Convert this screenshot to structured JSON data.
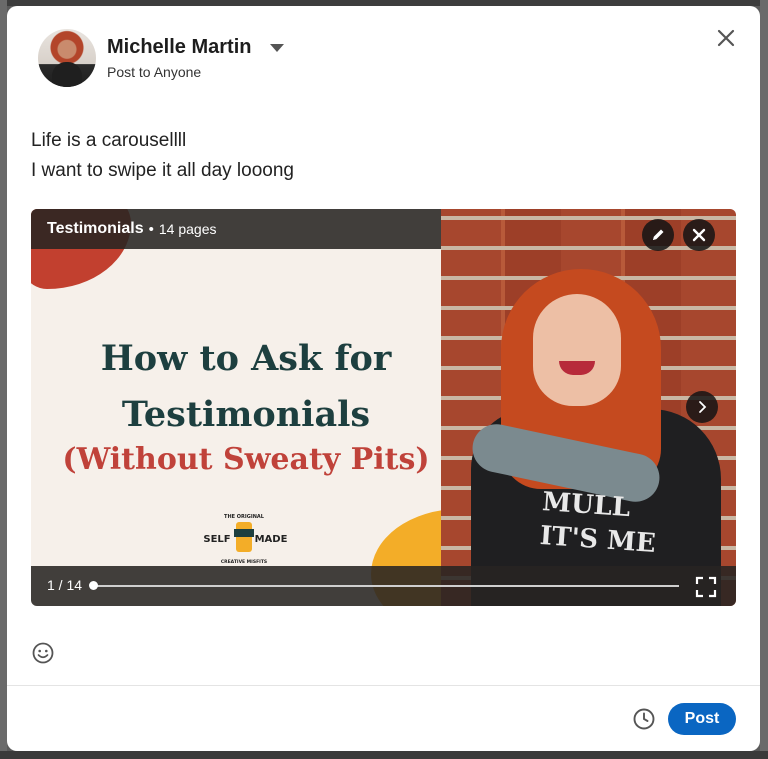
{
  "author": {
    "name": "Michelle Martin",
    "audience": "Post to Anyone"
  },
  "post": {
    "lines": [
      "Life is a carousellll",
      "I want to swipe it all day looong"
    ]
  },
  "document": {
    "title": "Testimonials",
    "separator": "•",
    "pages_label": "14 pages",
    "slide_title_line1": "How to Ask for",
    "slide_title_line2": "Testimonials",
    "slide_subtitle": "(Without Sweaty Pits)",
    "brand_top": "THE ORIGINAL",
    "brand_left": "SELF",
    "brand_right": "MADE",
    "brand_bottom": "CREATIVE MISFITS",
    "shirt_text_line1": "MULL",
    "shirt_text_line2": "IT'S ME",
    "page_counter": "1 / 14",
    "progress": 0.0
  },
  "footer": {
    "post_label": "Post"
  },
  "icons": {
    "close": "close-icon",
    "dropdown": "caret-down-icon",
    "edit": "pencil-icon",
    "remove": "close-icon",
    "next": "chevron-right-icon",
    "fullscreen": "fullscreen-icon",
    "emoji": "emoji-icon",
    "schedule": "clock-icon"
  },
  "colors": {
    "primary": "#0a66c2",
    "slide_title": "#1d3f3f",
    "slide_subtitle": "#c0423a",
    "accent_yellow": "#f3ad28"
  }
}
